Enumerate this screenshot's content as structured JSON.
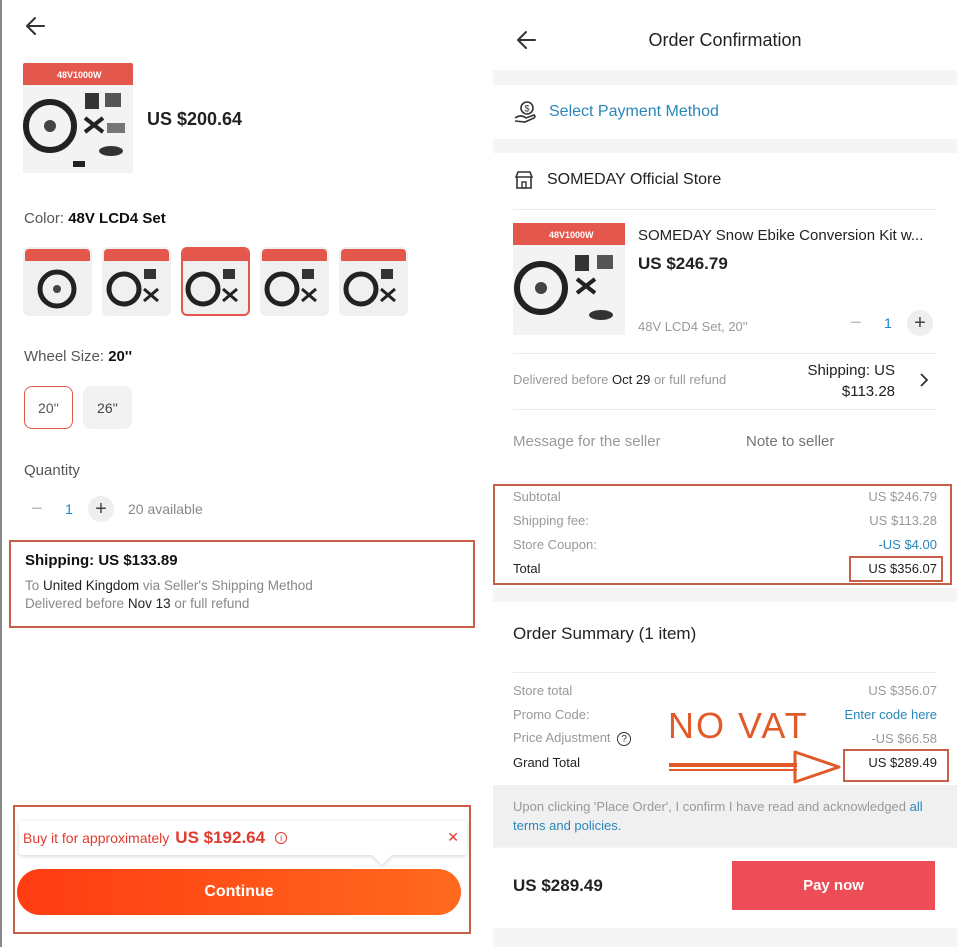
{
  "left": {
    "price": "US $200.64",
    "color_label": "Color:",
    "color_value": "48V LCD4 Set",
    "wheel_label": "Wheel Size:",
    "wheel_value": "20''",
    "sizes": [
      "20''",
      "26''"
    ],
    "quantity_label": "Quantity",
    "quantity": "1",
    "available": "20 available",
    "shipping_title": "Shipping: US $133.89",
    "ship_to_prefix": "To",
    "ship_to_country": "United Kingdom",
    "ship_via": "via Seller's Shipping Method",
    "delivered_prefix": "Delivered before",
    "delivered_date": "Nov 13",
    "delivered_suffix": "or full refund",
    "approx_text": "Buy it for approximately",
    "approx_price": "US $192.64",
    "continue_label": "Continue",
    "thumb_banner": "48V1000W"
  },
  "right": {
    "title": "Order Confirmation",
    "payment_method": "Select Payment Method",
    "store_name": "SOMEDAY Official Store",
    "product_title": "SOMEDAY Snow Ebike Conversion Kit w...",
    "product_price": "US $246.79",
    "variant": "48V LCD4 Set, 20''",
    "quantity": "1",
    "delivered_prefix": "Delivered before",
    "delivered_date": "Oct 29",
    "delivered_suffix": "or full refund",
    "shipping_line1": "Shipping: US",
    "shipping_line2": "$113.28",
    "message_label": "Message for the seller",
    "message_placeholder": "Note to seller",
    "totals": {
      "subtotal_label": "Subtotal",
      "subtotal": "US $246.79",
      "shipping_label": "Shipping fee:",
      "shipping": "US $113.28",
      "coupon_label": "Store Coupon:",
      "coupon": "-US $4.00",
      "total_label": "Total",
      "total": "US $356.07"
    },
    "summary": {
      "title": "Order Summary (1 item)",
      "store_total_label": "Store total",
      "store_total": "US $356.07",
      "promo_label": "Promo Code:",
      "promo_value": "Enter code here",
      "adjust_label": "Price Adjustment",
      "adjust_value": "-US $66.58",
      "grand_label": "Grand Total",
      "grand_value": "US $289.49"
    },
    "terms_text": "Upon clicking 'Place Order', I confirm I have read and acknowledged",
    "terms_link": "all terms and policies.",
    "bottom_price": "US $289.49",
    "pay_now": "Pay now"
  },
  "annotation": {
    "text": "NO VAT",
    "color": "#e05a2a"
  },
  "colors": {
    "accent_red": "#e4574d",
    "link_blue": "#2a86b8",
    "annotation_box": "#c86048"
  }
}
